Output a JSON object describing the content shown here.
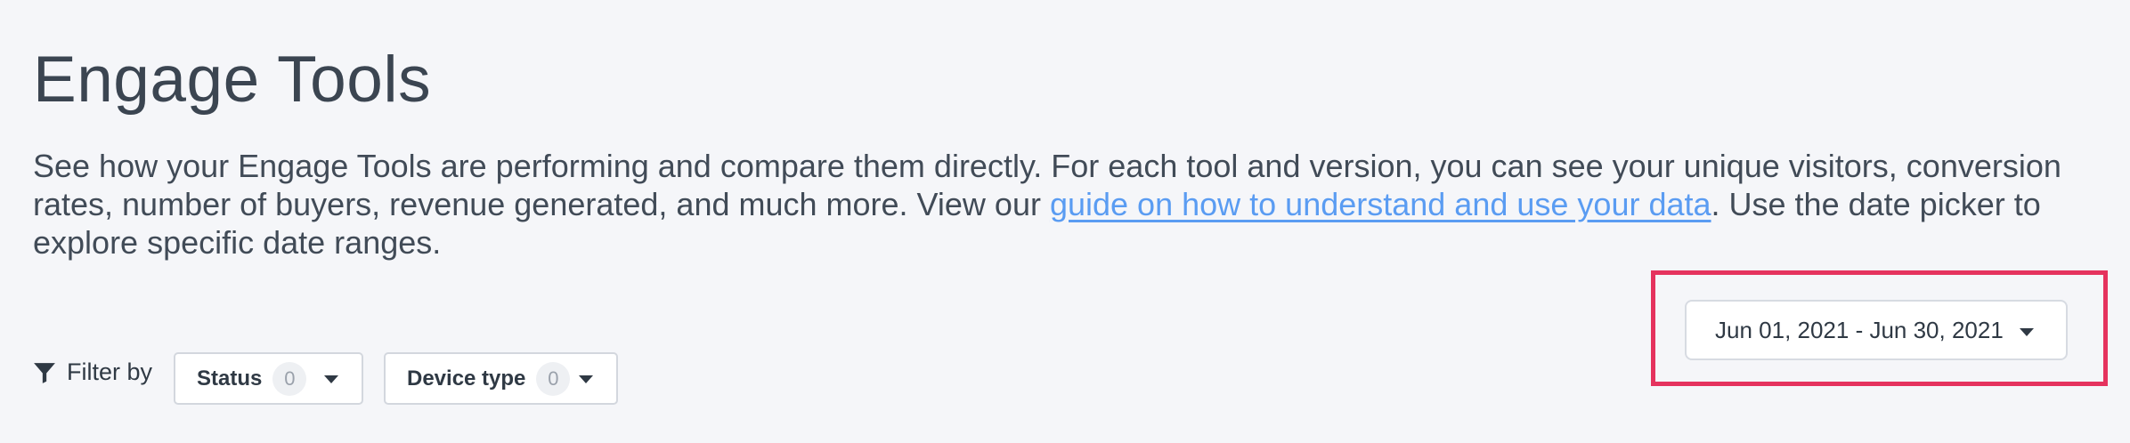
{
  "page": {
    "title": "Engage Tools",
    "description": {
      "before_link": "See how your Engage Tools are performing and compare them directly. For each tool and version, you can see your unique visitors, conversion rates, number of buyers, revenue generated, and much more. View our ",
      "link_text": "guide on how to understand and use your data",
      "after_link": ". Use the date picker to explore specific date ranges."
    }
  },
  "date_picker": {
    "label": "Jun 01, 2021 - Jun 30, 2021",
    "icon": "chevron-down-icon"
  },
  "filters": {
    "label": "Filter by",
    "icon": "funnel-icon",
    "items": [
      {
        "label": "Status",
        "count": "0"
      },
      {
        "label": "Device type",
        "count": "0"
      }
    ]
  },
  "colors": {
    "background": "#f5f6f9",
    "link": "#5a9cf2",
    "highlight": "#e5335e",
    "text": "#3d4753"
  }
}
